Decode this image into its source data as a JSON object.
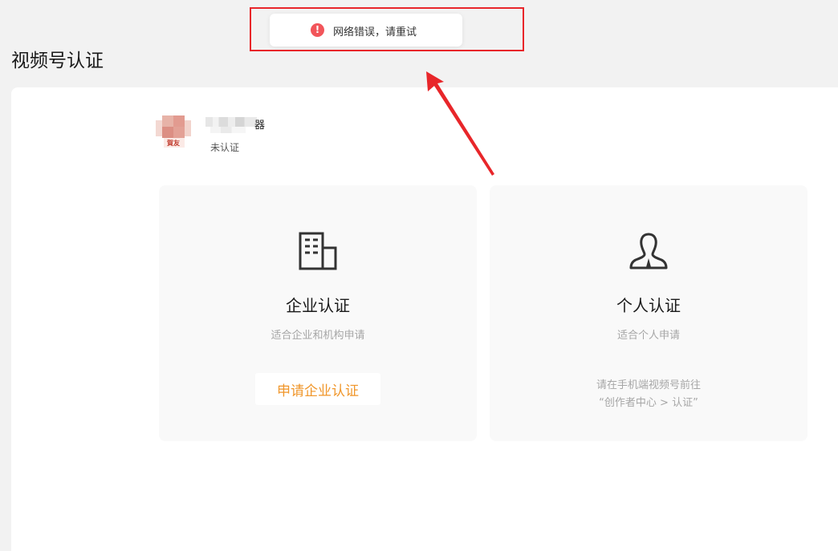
{
  "page": {
    "title": "视频号认证"
  },
  "toast": {
    "icon": "error-icon",
    "message": "网络错误，请重试"
  },
  "account": {
    "name_visible_tail": "器",
    "status": "未认证",
    "avatar_text": "賀友"
  },
  "options": {
    "enterprise": {
      "icon": "building-icon",
      "title": "企业认证",
      "subtitle": "适合企业和机构申请",
      "button_label": "申请企业认证"
    },
    "personal": {
      "icon": "person-icon",
      "title": "个人认证",
      "subtitle": "适合个人申请",
      "hint_line1": "请在手机端视频号前往",
      "hint_line2": "“创作者中心 > 认证”"
    }
  },
  "colors": {
    "accent": "#f0962a",
    "error": "#f2555a",
    "annotation": "#e8262a",
    "card_bg": "#f9f9f9",
    "page_bg": "#f2f2f2"
  }
}
